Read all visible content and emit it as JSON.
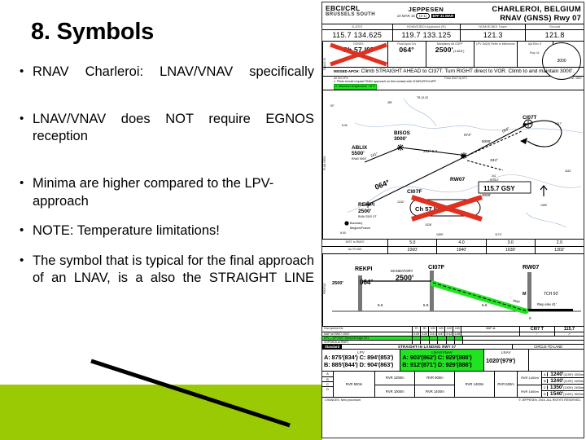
{
  "slide": {
    "title": "8. Symbols",
    "bullets": [
      {
        "text": "RNAV  Charleroi:  LNAV/VNAV specifically",
        "justify": true
      },
      {
        "text": "LNAV/VNAV  does  NOT  require EGNOS reception",
        "justify": true
      },
      {
        "text": "Minima are higher compared to the LPV-approach",
        "justify": false
      },
      {
        "text": "NOTE: Temperature limitations!",
        "justify": false
      },
      {
        "text": "The  symbol  that  is  typical  for the  final  approach  of  an  LNAV, is a also the STRAIGHT LINE",
        "justify": true
      }
    ],
    "bullet_marker": "•",
    "band_color": "#9ACA04",
    "line_color": "#000000"
  },
  "chart": {
    "header": {
      "icao": "EBCI/CRL",
      "airport": "BRUSSELS SOUTH",
      "brand": "JEPPESEN",
      "date": "10 MAR 16",
      "index": "(2-1)",
      "effective": "EFF 31 MAR",
      "city": "CHARLEROI, BELGIUM",
      "procedure": "RNAV (GNSS) Rwy 07"
    },
    "frequencies": {
      "headers": [
        "D-ATIS",
        "HOMVEJBOI Approach (R)",
        "HOMVEJBOI Tower",
        "Ground"
      ],
      "values": [
        "115.7     134.625",
        "119.7     133.125",
        "121.3",
        "121.8"
      ]
    },
    "briefing": {
      "cells": [
        {
          "label": "DGNSS",
          "value": "Ch 57 I07",
          "sub": "I07A",
          "crossed": true
        },
        {
          "label": "Final Apch Crs",
          "value": "064°"
        },
        {
          "label": "Mandatory Alt GSPF",
          "value": "2500'",
          "sub": "(1465')"
        },
        {
          "label": "LPV  DA(H)  Refer to Minimums",
          "value": ""
        },
        {
          "label": "Apt Elev  4'",
          "value": ""
        },
        {
          "label": "Rwy  41'",
          "value": ""
        }
      ],
      "msa_circle": "3000",
      "missed_label": "MISSED APCH:",
      "missed_text": "Climb STRAIGHT AHEAD to CI37T. Turn RIGHT direct to VOR. Climb to and maintain 3000'.",
      "notes_header": [
        "Alt Set: hPa",
        "Trans level: by ATC",
        "Trans alt: 4500'"
      ],
      "note1": "1. Pilots should request RNAV approach on first contact with CHARLEROI APP.",
      "note2": "2. Minimum temperature -10°C",
      "note2_highlight": "#22E322"
    },
    "planview": {
      "side_label": "PLAN VIEW",
      "waypoints": [
        {
          "name": "ABLIX",
          "alt": "5500'",
          "note": "RNAV 5500'"
        },
        {
          "name": "BISOS",
          "alt": "3000'"
        },
        {
          "name": "REKPI",
          "alt": "2500'",
          "note": "RNAV 2500'"
        },
        {
          "name": "CI07F"
        },
        {
          "name": "CI07T"
        },
        {
          "name": "RW07"
        }
      ],
      "tracks": [
        "241°",
        "261°  6.4",
        "064°",
        "074°",
        "064°",
        "334°"
      ],
      "altitudes": [
        "3000'",
        "5000'"
      ],
      "vor_box": "115.7  GSY",
      "vor_box_sub": "3000'",
      "crossed_box": "Ch 57  I07 A",
      "boundary_note": "Boundary Belgium/France",
      "spot_elevs": [
        "1242'",
        "1026'",
        "1065'",
        "1192'",
        "1089'",
        "1174'",
        "1361'"
      ]
    },
    "strip": {
      "dist_label": "DIST to RW07",
      "alt_label": "ALTITUDE",
      "dist_values": [
        "5.0",
        "4.0",
        "3.0",
        "2.0"
      ],
      "alt_values": [
        "2260'",
        "1940'",
        "1630'",
        "1302'"
      ]
    },
    "profile": {
      "side_label": "PROFILE",
      "fix_left": "REKPI",
      "fix_left_alt": "2500'",
      "course": "064°",
      "mandatory_label": "MANDATORY",
      "mandatory_alt": "2500'",
      "fix_mid": "CI07F",
      "fix_right": "RW07",
      "gs_angle": "TCH 50'",
      "rwy_elev": "Rwy elev 41'",
      "distances": [
        "9.6",
        "5.9",
        "6.6",
        "0"
      ],
      "highlight": "#22E322"
    },
    "speed_table": {
      "rows": [
        {
          "label": "Gnd speed-Kts",
          "values": [
            "70",
            "90",
            "100",
            "120",
            "140",
            "160"
          ],
          "highlight": false
        },
        {
          "label": "MAP at RW07   2500'",
          "values": [
            "3:28",
            "4:26",
            "3:41",
            "4:57",
            "2:42",
            "2:45"
          ],
          "highlight": false
        },
        {
          "label": "LPV  –  GP  3.00°  Descent Angle  521",
          "values": [
            "",
            "",
            "",
            "",
            "",
            ""
          ],
          "highlight": true
        },
        {
          "label": "VDP/MDA at RW07",
          "values": [
            "",
            "",
            "",
            "",
            "",
            ""
          ],
          "highlight": false
        }
      ],
      "map_label": "MAP at",
      "vor_ident": "CI07 T",
      "vor_freq": "115.7"
    },
    "minimums": {
      "standard_label": "Standard",
      "straight_in_label": "STRAIGHT-IN LANDING RWY 07",
      "circle_label": "CIRCLE-TO-LAND",
      "columns": [
        {
          "name": "LPV",
          "sub": "DA(H)",
          "rows": [
            "A: 875'(834')  C: 894'(853')",
            "B: 885'(844')  D: 904'(863')"
          ],
          "highlight": false
        },
        {
          "name": "LNAV/VNAV",
          "sub": "DA(H)",
          "rows": [
            "A: 903'(862')  C: 929'(888')",
            "B: 912'(871')  D: 929'(888')"
          ],
          "highlight": true
        },
        {
          "name": "LNAV",
          "sub": "MDA(H)",
          "rows": [
            "1020'(979')"
          ],
          "highlight": false
        }
      ],
      "rvr_hdr": [
        "RVR 40",
        "",
        "RVR 50",
        "RVR 60"
      ],
      "abcd": [
        "A",
        "B",
        "C",
        "D"
      ],
      "rvr_cells": [
        "RVR 500m",
        "RVR 1300m",
        "RVR 1400m",
        "RVR 900m",
        "RVR 1000m",
        "RVR 1400m",
        "RVR 1600m"
      ],
      "ctl_rows": [
        {
          "cat": "A",
          "mda": "1240'",
          "hgt": "(1199')",
          "vis": "1500m"
        },
        {
          "cat": "B",
          "mda": "1240'",
          "hgt": "(1199')",
          "vis": "1600m"
        },
        {
          "cat": "C",
          "mda": "1350'",
          "hgt": "(1309')",
          "vis": "2400m"
        },
        {
          "cat": "D",
          "mda": "1540'",
          "hgt": "(1499')",
          "vis": "3600m"
        }
      ],
      "footer_left": "CHANGES:  New procedure.",
      "footer_right": "© JEPPESEN, 2016. ALL RIGHTS RESERVED."
    },
    "side_vertical": "21 AUG 15"
  }
}
